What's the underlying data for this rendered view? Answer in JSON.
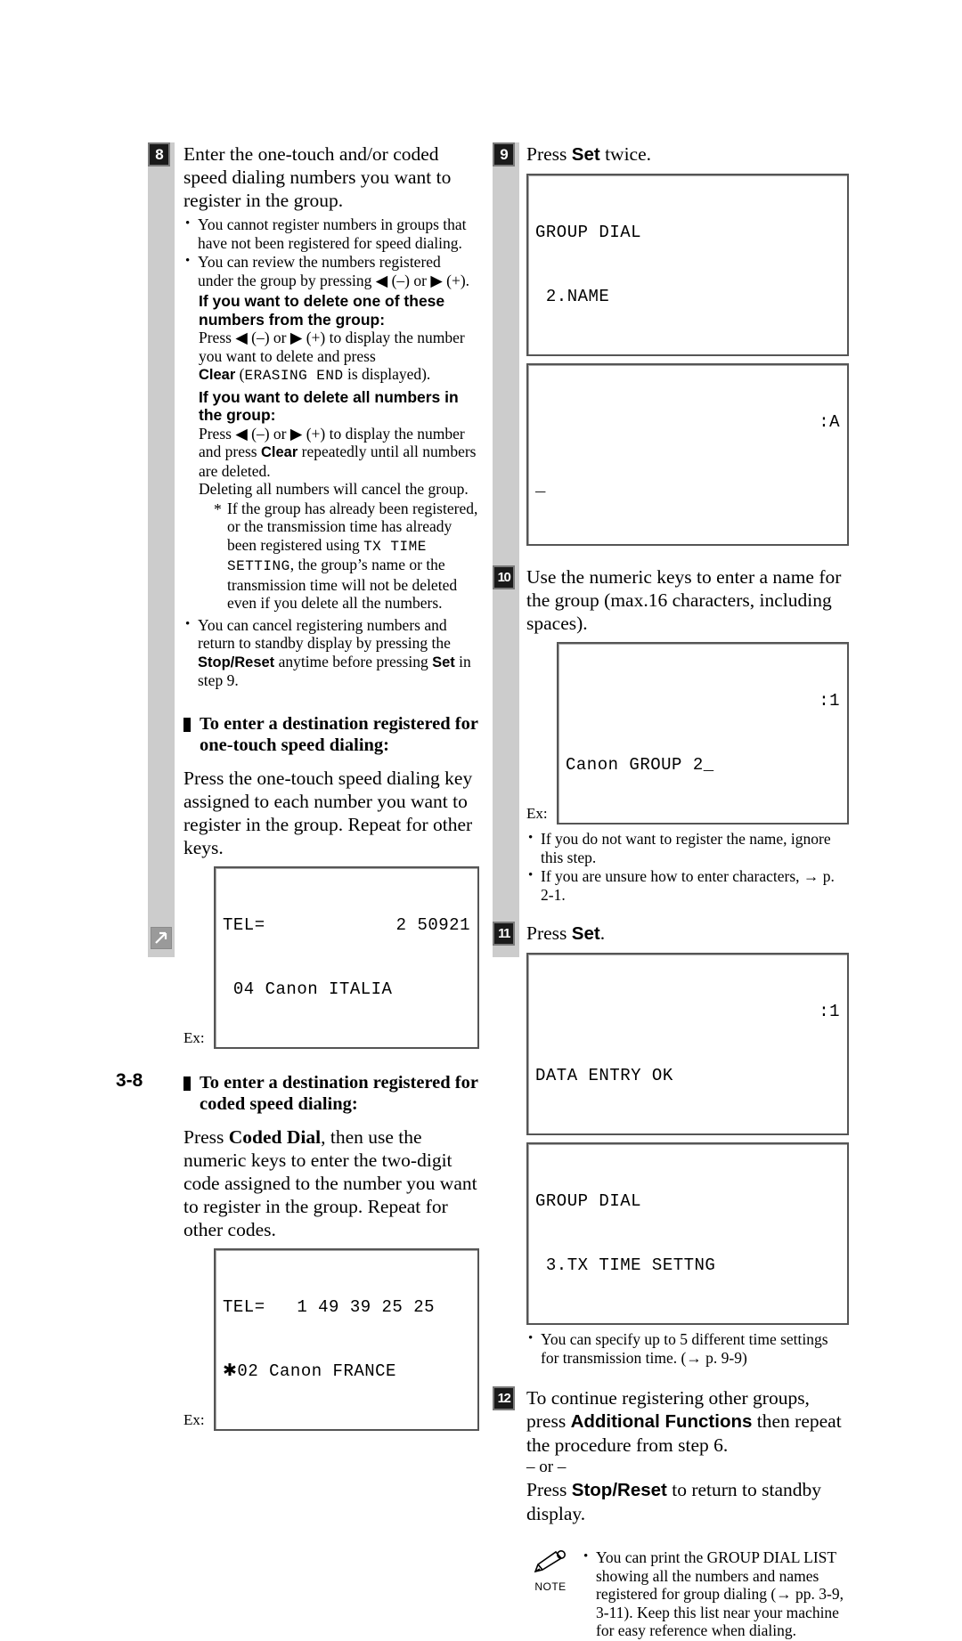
{
  "page": {
    "number": "3-8"
  },
  "left_column": {
    "step8": {
      "badge": "8",
      "text_parts": [
        "Enter the one-touch and/or coded speed dialing numbers you want to register in the group."
      ],
      "bullets": [
        "You cannot register numbers in groups that have not been registered for speed dialing.",
        "You can review the numbers registered under the group by pressing ◀ (–) or ▶ (+)."
      ],
      "delete_one": {
        "heading": "If you want to delete one of these numbers from the group:",
        "text_a": "Press ◀ (–) or ▶ (+) to display the number you want to delete and press ",
        "clear_label": "Clear",
        "mono_a": "ERASING END",
        "text_b": " is displayed)."
      },
      "delete_all": {
        "heading": "If you want to delete all numbers in the group:",
        "text_a": "Press ◀ (–) or ▶ (+) to display the number and press ",
        "clear_label": "Clear",
        "text_b": " repeatedly until all numbers are deleted.",
        "text_c": "Deleting all numbers will cancel the group.",
        "star_a": "If the group has already been registered, or the transmission time has already been registered using ",
        "star_mono": "TX TIME SETTING",
        "star_b": ", the group’s name or the transmission time will not be deleted even if you delete all the numbers."
      },
      "cancel_bullet": {
        "text_a": "You can cancel registering numbers and return to standby display by pressing the ",
        "stop_label": "Stop/Reset",
        "text_b": " anytime before pressing ",
        "set_label": "Set",
        "text_c": " in step 9."
      }
    },
    "section_onetouch": {
      "heading_line1": "To enter a destination registered for",
      "heading_line2": "one-touch speed dialing:",
      "paragraph": "Press the one-touch speed dialing key assigned to each number you want to register in the group. Repeat for other keys.",
      "example_label": "Ex:",
      "lcd": {
        "line1_left": "TEL=",
        "line1_right": "2 50921",
        "line2": " 04 Canon ITALIA"
      }
    },
    "section_coded": {
      "heading_line1": "To enter a destination registered for",
      "heading_line2": "coded speed dialing:",
      "paragraph_a": "Press ",
      "coded_dial_label": "Coded Dial",
      "paragraph_b": ", then use the numeric keys to enter the two-digit code assigned to the number you want to register in the group. Repeat for other codes.",
      "example_label": "Ex:",
      "lcd": {
        "line1": "TEL=   1 49 39 25 25",
        "line2": "✱02 Canon FRANCE"
      }
    }
  },
  "right_column": {
    "step9": {
      "badge": "9",
      "text_a": "Press ",
      "set_label": "Set",
      "text_b": " twice.",
      "lcd1": {
        "line1": "GROUP DIAL",
        "line2": " 2.NAME"
      },
      "lcd2": {
        "line1_left": "",
        "line1_right": ":A",
        "line2": "_"
      }
    },
    "step10": {
      "badge": "10",
      "text": "Use the numeric keys to enter a name for the group (max.16 characters, including spaces).",
      "example_label": "Ex:",
      "lcd": {
        "line1_left": "",
        "line1_right": ":1",
        "line2": "Canon GROUP 2_"
      },
      "bullets": [
        "If you do not want to register the name, ignore this step.",
        "If you are unsure how to enter characters, → p. 2-1."
      ]
    },
    "step11": {
      "badge": "11",
      "text_a": "Press ",
      "set_label": "Set",
      "text_b": ".",
      "lcd1": {
        "line1_left": "",
        "line1_right": ":1",
        "line2": "DATA ENTRY OK"
      },
      "lcd2": {
        "line1": "GROUP DIAL",
        "line2": " 3.TX TIME SETTNG"
      },
      "bullets": [
        "You can specify up to 5 different time settings for transmission time. (→ p. 9-9)"
      ]
    },
    "step12": {
      "badge": "12",
      "text_a": "To continue registering other groups, press ",
      "addfunc_label": "Additional Functions",
      "text_b": " then repeat the procedure from step 6.",
      "or_text": "– or –",
      "text_c": "Press ",
      "stop_label": "Stop/Reset",
      "text_d": " to return to standby display."
    },
    "note": {
      "icon_name": "pencil-icon",
      "label": "NOTE",
      "bullets": [
        "You can print the GROUP DIAL LIST showing all the numbers and names registered for group dialing (→ pp. 3-9, 3-11). Keep this list near your machine for easy reference when dialing."
      ]
    }
  }
}
